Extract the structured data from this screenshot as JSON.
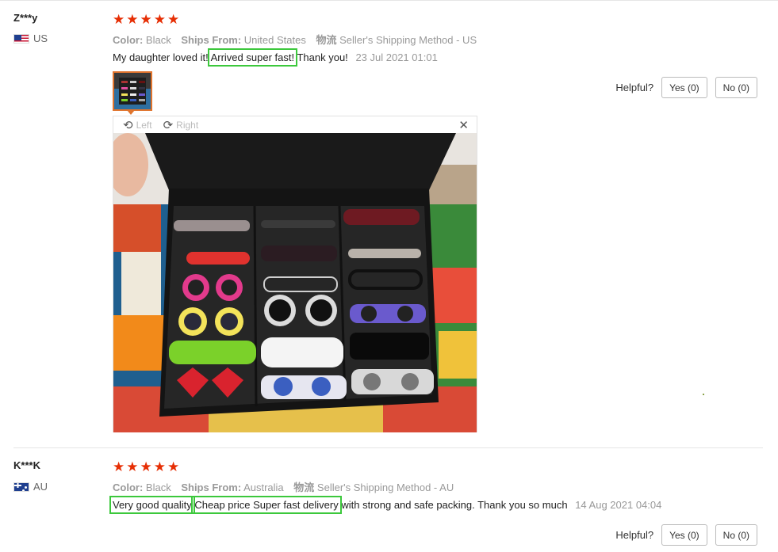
{
  "reviews": [
    {
      "user": "Z***y",
      "country": "US",
      "color_label": "Color:",
      "color_value": "Black",
      "ships_label": "Ships From:",
      "ships_value": "United States",
      "shipping_label": "物流",
      "shipping_value": "Seller's Shipping Method - US",
      "text_a": "My daughter loved it!",
      "text_b": "Arrived super fast!",
      "text_c": "Thank you!",
      "date": "23 Jul 2021 01:01",
      "helpful_label": "Helpful?",
      "yes_label": "Yes (0)",
      "no_label": "No (0)",
      "rating": 5
    },
    {
      "user": "K***K",
      "country": "AU",
      "color_label": "Color:",
      "color_value": "Black",
      "ships_label": "Ships From:",
      "ships_value": "Australia",
      "shipping_label": "物流",
      "shipping_value": "Seller's Shipping Method - AU",
      "text_a": "Very good quality",
      "text_b": "Cheap price Super fast delivery",
      "text_c": "with strong and safe packing. Thank you so much",
      "date": "14 Aug 2021 04:04",
      "helpful_label": "Helpful?",
      "yes_label": "Yes (0)",
      "no_label": "No (0)",
      "rating": 5
    }
  ],
  "viewer": {
    "rotate_left_label": "Left",
    "rotate_right_label": "Right",
    "close_glyph": "✕"
  },
  "colors": {
    "star": "#e62e04",
    "highlight": "#3cc83c",
    "thumb_border": "#e0742d"
  }
}
